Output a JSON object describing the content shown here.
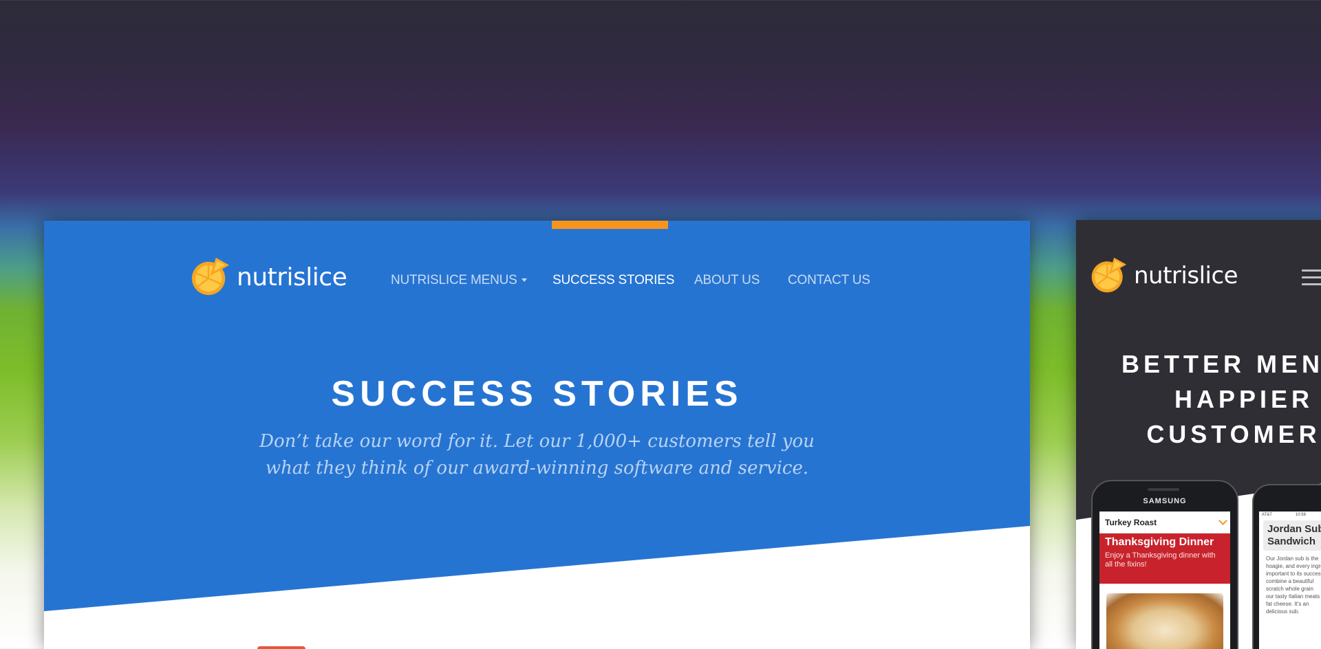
{
  "desktop": {
    "logo_text": "nutrislice",
    "nav": [
      {
        "label": "NUTRISLICE MENUS"
      },
      {
        "label": "SUCCESS STORIES"
      },
      {
        "label": "ABOUT US"
      },
      {
        "label": "CONTACT US"
      }
    ],
    "active_nav": "SUCCESS STORIES",
    "hero_title": "SUCCESS STORIES",
    "hero_subtitle_lines": [
      "Don’t take our word for it. Let our 1,000+ customers tell you",
      "what they think of our award-winning software and service."
    ]
  },
  "mobile": {
    "logo_text": "nutrislice",
    "headline_lines": [
      "BETTER MENUS",
      "HAPPIER",
      "CUSTOMERS"
    ],
    "phone1": {
      "brand": "SAMSUNG",
      "menu_select": "Turkey Roast",
      "feature_title": "Thanksgiving Dinner",
      "feature_desc": "Enjoy a Thanksgiving dinner with all the fixins!"
    },
    "phone2": {
      "carrier": "AT&T",
      "time": "10:56",
      "title_lines": [
        "Jordan Sub",
        "Sandwich"
      ],
      "description_lines": [
        "Our Jordan sub is the",
        "hoagie, and every ingredient",
        "important to its success.",
        "combine a beautiful",
        "scratch whole grain",
        "our tasty Italian meats",
        "fat cheese. It's an",
        "delicious sub."
      ]
    }
  },
  "colors": {
    "hero_blue": "#2674d2",
    "accent_orange": "#f7941d",
    "mobile_dark": "#2f2e35",
    "logo_orange": "#f5a623"
  }
}
